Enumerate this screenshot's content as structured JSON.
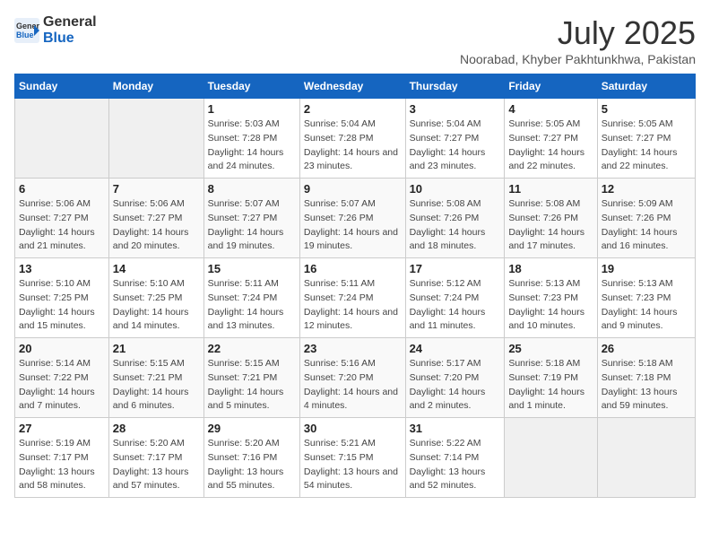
{
  "header": {
    "logo_general": "General",
    "logo_blue": "Blue",
    "month": "July 2025",
    "location": "Noorabad, Khyber Pakhtunkhwa, Pakistan"
  },
  "weekdays": [
    "Sunday",
    "Monday",
    "Tuesday",
    "Wednesday",
    "Thursday",
    "Friday",
    "Saturday"
  ],
  "weeks": [
    [
      {
        "day": "",
        "empty": true
      },
      {
        "day": "",
        "empty": true
      },
      {
        "day": "1",
        "sunrise": "5:03 AM",
        "sunset": "7:28 PM",
        "daylight": "14 hours and 24 minutes."
      },
      {
        "day": "2",
        "sunrise": "5:04 AM",
        "sunset": "7:28 PM",
        "daylight": "14 hours and 23 minutes."
      },
      {
        "day": "3",
        "sunrise": "5:04 AM",
        "sunset": "7:27 PM",
        "daylight": "14 hours and 23 minutes."
      },
      {
        "day": "4",
        "sunrise": "5:05 AM",
        "sunset": "7:27 PM",
        "daylight": "14 hours and 22 minutes."
      },
      {
        "day": "5",
        "sunrise": "5:05 AM",
        "sunset": "7:27 PM",
        "daylight": "14 hours and 22 minutes."
      }
    ],
    [
      {
        "day": "6",
        "sunrise": "5:06 AM",
        "sunset": "7:27 PM",
        "daylight": "14 hours and 21 minutes."
      },
      {
        "day": "7",
        "sunrise": "5:06 AM",
        "sunset": "7:27 PM",
        "daylight": "14 hours and 20 minutes."
      },
      {
        "day": "8",
        "sunrise": "5:07 AM",
        "sunset": "7:27 PM",
        "daylight": "14 hours and 19 minutes."
      },
      {
        "day": "9",
        "sunrise": "5:07 AM",
        "sunset": "7:26 PM",
        "daylight": "14 hours and 19 minutes."
      },
      {
        "day": "10",
        "sunrise": "5:08 AM",
        "sunset": "7:26 PM",
        "daylight": "14 hours and 18 minutes."
      },
      {
        "day": "11",
        "sunrise": "5:08 AM",
        "sunset": "7:26 PM",
        "daylight": "14 hours and 17 minutes."
      },
      {
        "day": "12",
        "sunrise": "5:09 AM",
        "sunset": "7:26 PM",
        "daylight": "14 hours and 16 minutes."
      }
    ],
    [
      {
        "day": "13",
        "sunrise": "5:10 AM",
        "sunset": "7:25 PM",
        "daylight": "14 hours and 15 minutes."
      },
      {
        "day": "14",
        "sunrise": "5:10 AM",
        "sunset": "7:25 PM",
        "daylight": "14 hours and 14 minutes."
      },
      {
        "day": "15",
        "sunrise": "5:11 AM",
        "sunset": "7:24 PM",
        "daylight": "14 hours and 13 minutes."
      },
      {
        "day": "16",
        "sunrise": "5:11 AM",
        "sunset": "7:24 PM",
        "daylight": "14 hours and 12 minutes."
      },
      {
        "day": "17",
        "sunrise": "5:12 AM",
        "sunset": "7:24 PM",
        "daylight": "14 hours and 11 minutes."
      },
      {
        "day": "18",
        "sunrise": "5:13 AM",
        "sunset": "7:23 PM",
        "daylight": "14 hours and 10 minutes."
      },
      {
        "day": "19",
        "sunrise": "5:13 AM",
        "sunset": "7:23 PM",
        "daylight": "14 hours and 9 minutes."
      }
    ],
    [
      {
        "day": "20",
        "sunrise": "5:14 AM",
        "sunset": "7:22 PM",
        "daylight": "14 hours and 7 minutes."
      },
      {
        "day": "21",
        "sunrise": "5:15 AM",
        "sunset": "7:21 PM",
        "daylight": "14 hours and 6 minutes."
      },
      {
        "day": "22",
        "sunrise": "5:15 AM",
        "sunset": "7:21 PM",
        "daylight": "14 hours and 5 minutes."
      },
      {
        "day": "23",
        "sunrise": "5:16 AM",
        "sunset": "7:20 PM",
        "daylight": "14 hours and 4 minutes."
      },
      {
        "day": "24",
        "sunrise": "5:17 AM",
        "sunset": "7:20 PM",
        "daylight": "14 hours and 2 minutes."
      },
      {
        "day": "25",
        "sunrise": "5:18 AM",
        "sunset": "7:19 PM",
        "daylight": "14 hours and 1 minute."
      },
      {
        "day": "26",
        "sunrise": "5:18 AM",
        "sunset": "7:18 PM",
        "daylight": "13 hours and 59 minutes."
      }
    ],
    [
      {
        "day": "27",
        "sunrise": "5:19 AM",
        "sunset": "7:17 PM",
        "daylight": "13 hours and 58 minutes."
      },
      {
        "day": "28",
        "sunrise": "5:20 AM",
        "sunset": "7:17 PM",
        "daylight": "13 hours and 57 minutes."
      },
      {
        "day": "29",
        "sunrise": "5:20 AM",
        "sunset": "7:16 PM",
        "daylight": "13 hours and 55 minutes."
      },
      {
        "day": "30",
        "sunrise": "5:21 AM",
        "sunset": "7:15 PM",
        "daylight": "13 hours and 54 minutes."
      },
      {
        "day": "31",
        "sunrise": "5:22 AM",
        "sunset": "7:14 PM",
        "daylight": "13 hours and 52 minutes."
      },
      {
        "day": "",
        "empty": true
      },
      {
        "day": "",
        "empty": true
      }
    ]
  ]
}
